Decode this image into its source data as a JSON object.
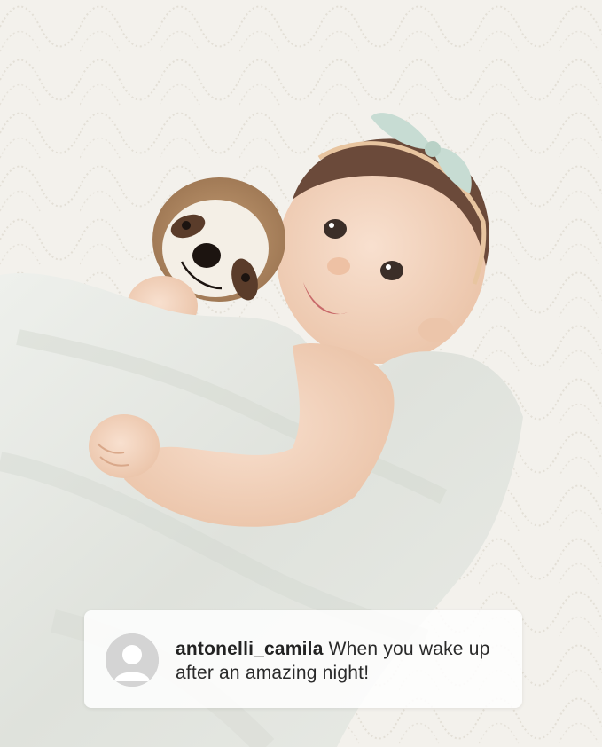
{
  "comment": {
    "username": "antonelli_camila",
    "text": "When you wake up after an amazing night!"
  },
  "icons": {
    "avatar": "default-user-avatar-icon"
  },
  "colors": {
    "quilt": "#f3f1ec",
    "blanket": "#e2e4df",
    "skin": "#f4d6c2",
    "hair": "#6b4a3a",
    "bow": "#c7dcd3",
    "sloth_fur": "#b28b63"
  }
}
